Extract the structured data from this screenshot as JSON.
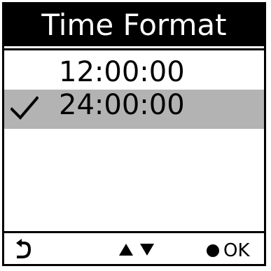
{
  "screen": {
    "title": "Time Format"
  },
  "options": [
    {
      "label": "12:00:00",
      "selected": false
    },
    {
      "label": "24:00:00",
      "selected": true
    }
  ],
  "footer": {
    "back_icon": "back-arrow-icon",
    "nav_icon": "up-down-arrows-icon",
    "ok_label": "OK"
  },
  "colors": {
    "title_bg": "#000000",
    "title_text": "#ffffff",
    "selected_row": "#b3b3b3"
  }
}
